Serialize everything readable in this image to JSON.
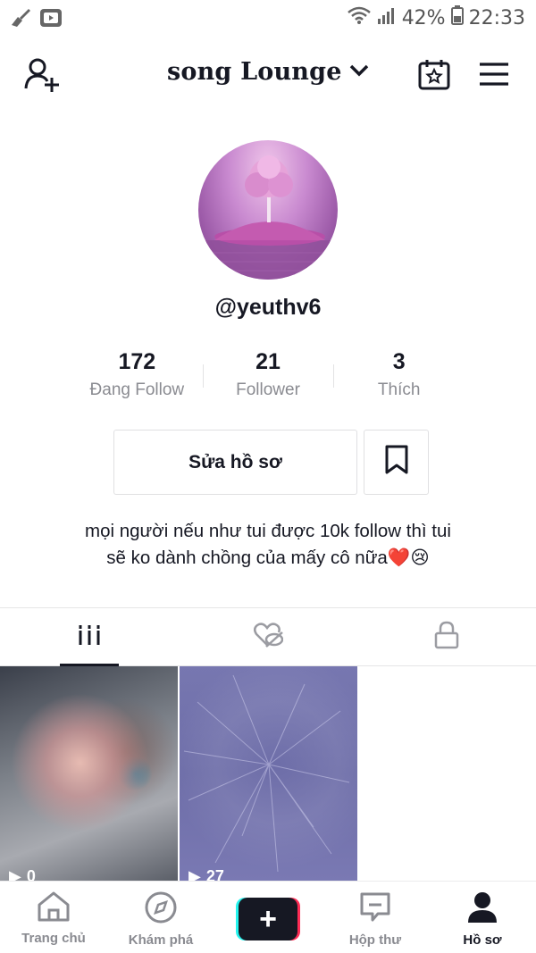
{
  "status_bar": {
    "battery": "42%",
    "time": "22:33",
    "left_icons": [
      "broom-icon",
      "youtube-icon"
    ],
    "right_icons": [
      "wifi-icon",
      "signal-icon",
      "battery-icon"
    ]
  },
  "header": {
    "title": "song Lounge",
    "icons": [
      "add-friend-icon",
      "chevron-down-icon",
      "calendar-star-icon",
      "menu-icon"
    ]
  },
  "profile": {
    "username": "@yeuthv6",
    "stats": [
      {
        "value": "172",
        "label": "Đang Follow"
      },
      {
        "value": "21",
        "label": "Follower"
      },
      {
        "value": "3",
        "label": "Thích"
      }
    ],
    "edit_label": "Sửa hồ sơ",
    "bio_line1": "mọi người nếu như tui được 10k follow thì tui",
    "bio_line2": "sẽ ko dành chồng của mấy cô nữa",
    "bio_emoji_heart": "❤️",
    "bio_emoji_sad": "😢"
  },
  "tabs": {
    "items": [
      "videos-grid-icon",
      "liked-hidden-icon",
      "private-lock-icon"
    ],
    "active_index": 0
  },
  "videos": [
    {
      "views": "0"
    },
    {
      "views": "27"
    }
  ],
  "bottom_nav": {
    "items": [
      {
        "label": "Trang chủ",
        "icon": "home-icon"
      },
      {
        "label": "Khám phá",
        "icon": "compass-icon"
      },
      {
        "label": "",
        "icon": "create-plus-icon"
      },
      {
        "label": "Hộp thư",
        "icon": "inbox-icon"
      },
      {
        "label": "Hồ sơ",
        "icon": "profile-icon"
      }
    ],
    "active_index": 4
  },
  "colors": {
    "text": "#161823",
    "muted": "#8a8b91",
    "accent_red": "#fe2c55",
    "accent_cyan": "#25f4ee"
  }
}
